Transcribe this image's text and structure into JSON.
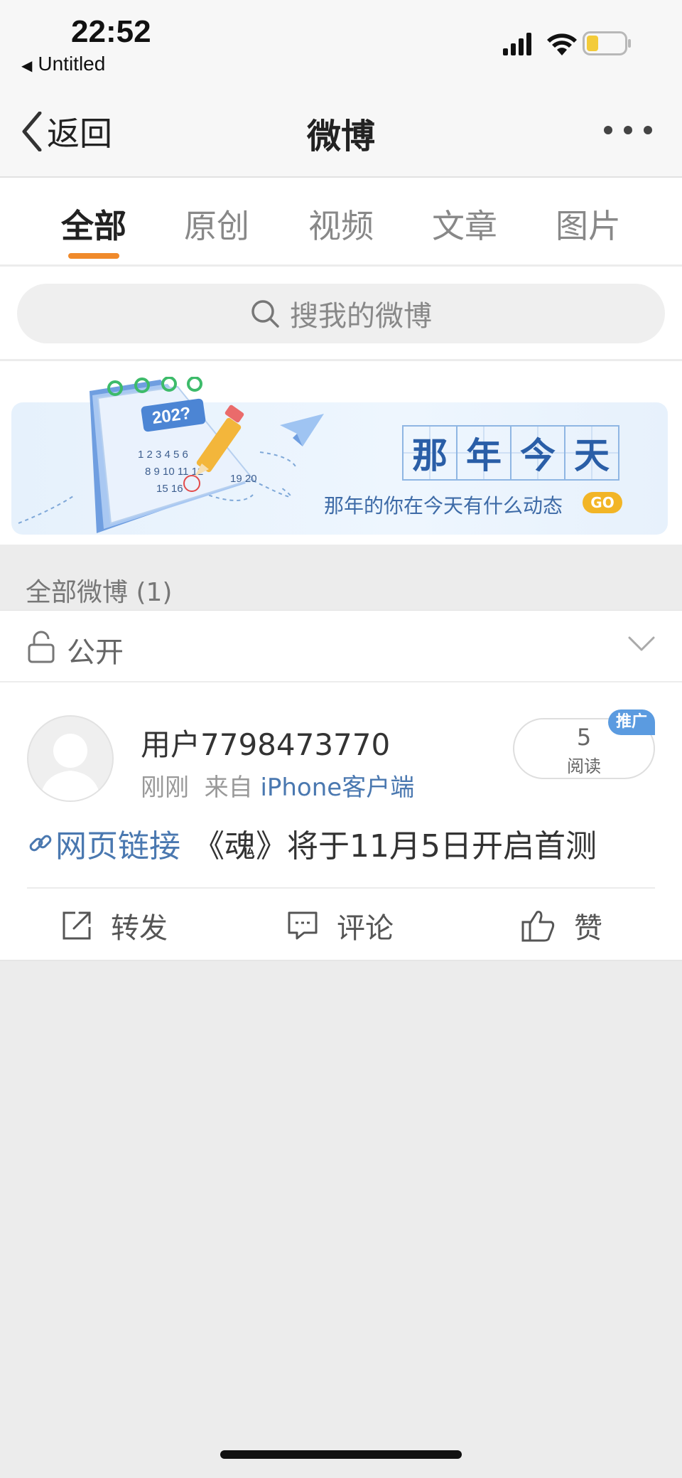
{
  "status_bar": {
    "time": "22:52",
    "back_app": "Untitled"
  },
  "nav": {
    "back_label": "返回",
    "title": "微博"
  },
  "tabs": [
    {
      "label": "全部",
      "active": true
    },
    {
      "label": "原创",
      "active": false
    },
    {
      "label": "视频",
      "active": false
    },
    {
      "label": "文章",
      "active": false
    },
    {
      "label": "图片",
      "active": false
    }
  ],
  "search": {
    "placeholder": "搜我的微博"
  },
  "banner": {
    "title_chars": [
      "那",
      "年",
      "今",
      "天"
    ],
    "subtitle": "那年的你在今天有什么动态",
    "go_label": "GO",
    "calendar_year": "202?"
  },
  "section": {
    "label": "全部微博 (1)"
  },
  "filter": {
    "label": "公开"
  },
  "post": {
    "username": "用户7798473770",
    "time": "刚刚",
    "source_prefix": "来自",
    "source": "iPhone客户端",
    "read_count": "5",
    "read_label": "阅读",
    "promo_badge": "推广",
    "link_label": "网页链接",
    "text": "《魂》将于11月5日开启首测",
    "actions": {
      "repost": "转发",
      "comment": "评论",
      "like": "赞"
    }
  },
  "colors": {
    "accent_orange": "#f08a2b",
    "link_blue": "#4a78b0",
    "badge_blue": "#5b9be0",
    "go_yellow": "#f2b526"
  }
}
